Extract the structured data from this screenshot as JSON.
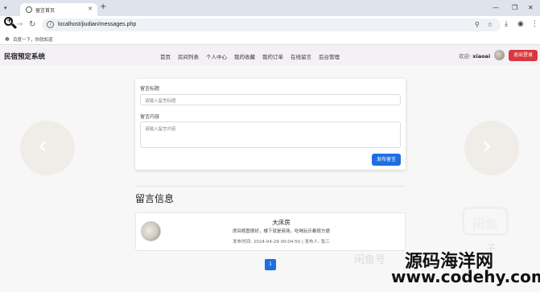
{
  "browser": {
    "tab_title": "留言首页",
    "url": "localhost/jiudian/messages.php",
    "bookmark": "百度一下，你就知道"
  },
  "site": {
    "brand": "民宿预定系统",
    "nav": [
      "首页",
      "房间列表",
      "个人中心",
      "我的收藏",
      "我的订单",
      "在线留言",
      "后台管理"
    ],
    "welcome_prefix": "欢迎:",
    "username": "xiaoai",
    "logout": "退出登录"
  },
  "form": {
    "title_label": "留言标题",
    "title_placeholder": "请输入留言标题",
    "content_label": "留言内容",
    "content_placeholder": "请输入留言内容",
    "submit": "发布留言"
  },
  "messages": {
    "heading": "留言信息",
    "items": [
      {
        "title": "大床房",
        "body": "房间视图很好，楼下就是商场，吃喝玩乐都很方便",
        "meta": "发布时间: 2024-04-29 00:04:50 | 发布人: 张三"
      }
    ]
  },
  "pagination": {
    "current": "1"
  },
  "watermark": {
    "logo": "闲鱼",
    "faint": "闲鱼号",
    "faint2": "子",
    "big": "源码海洋网",
    "url": "www.codehy.com"
  },
  "colors": {
    "primary": "#1e6fe0",
    "danger": "#d9363e",
    "navbar_bg": "#f4f1f6"
  }
}
